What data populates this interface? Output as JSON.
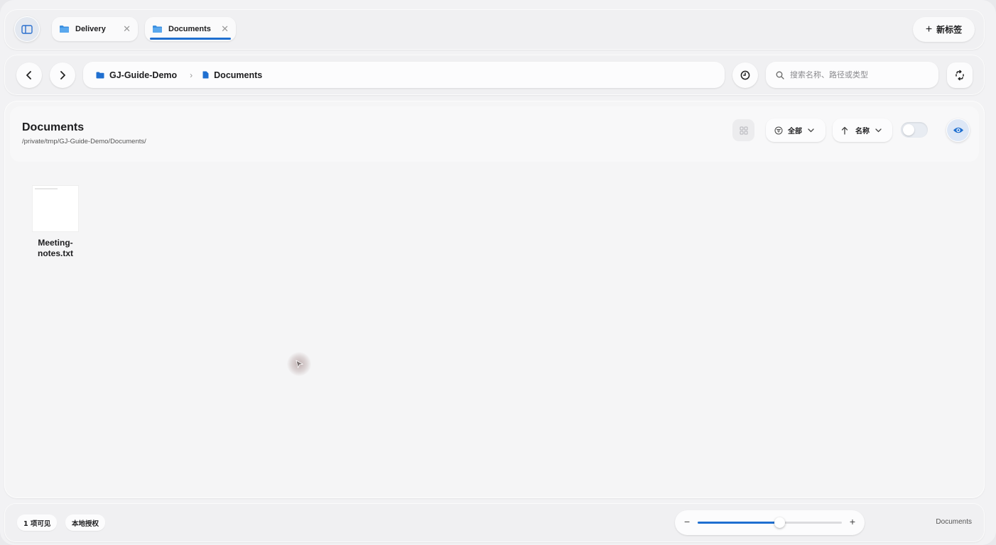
{
  "tabs": [
    {
      "label": "Delivery",
      "active": false
    },
    {
      "label": "Documents",
      "active": true
    }
  ],
  "new_tab_label": "新标签",
  "breadcrumb": {
    "root": "GJ-Guide-Demo",
    "current": "Documents"
  },
  "search": {
    "placeholder": "搜索名称、路径或类型",
    "value": ""
  },
  "header": {
    "title": "Documents",
    "path": "/private/tmp/GJ-Guide-Demo/Documents/"
  },
  "filter": {
    "label": "全部"
  },
  "sort": {
    "label": "名称",
    "direction": "ascending"
  },
  "preview_toggle": {
    "on": false
  },
  "files": [
    {
      "name": "Meeting-\nnotes.txt",
      "type": "txt"
    }
  ],
  "status": {
    "visible_count": "1 项可见",
    "authorization": "本地授权",
    "current_folder": "Documents"
  },
  "zoom": {
    "level": 0.57
  },
  "colors": {
    "accent": "#1f6fd0",
    "folder": "#2a7de1"
  },
  "icons": {
    "sidebar_toggle": "sidebar-icon",
    "back": "chevron-left-icon",
    "forward": "chevron-right-icon",
    "history": "clock-icon",
    "search": "search-icon",
    "sync": "sync-icon",
    "grid": "grid-icon",
    "filter": "filter-icon",
    "sort": "arrow-up-icon",
    "preview": "eye-icon"
  }
}
